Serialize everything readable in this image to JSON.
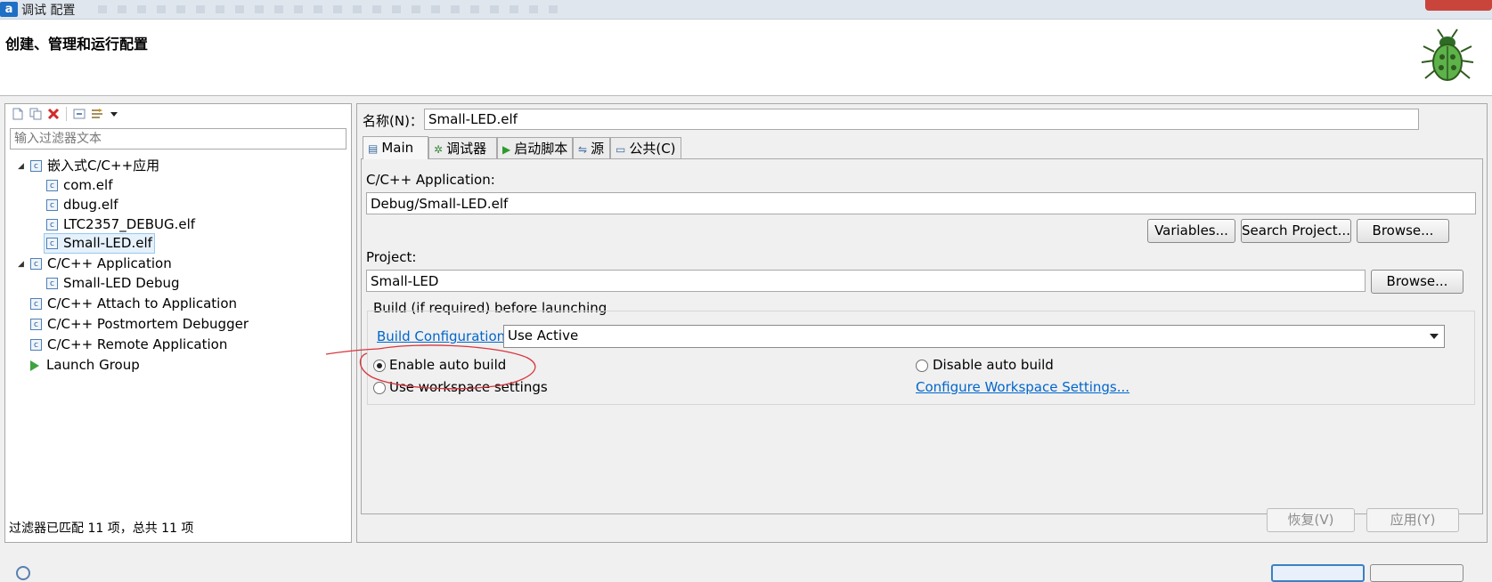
{
  "window": {
    "title": "调试 配置",
    "app_icon_glyph": "a"
  },
  "header": {
    "title": "创建、管理和运行配置",
    "icon": "bug-icon"
  },
  "left_panel": {
    "toolbar_icons": [
      "new-config-icon",
      "duplicate-icon",
      "delete-icon",
      "collapse-all-icon",
      "filter-icon",
      "dropdown-arrow-icon"
    ],
    "filter_placeholder": "输入过滤器文本",
    "tree": [
      {
        "label": "嵌入式C/C++应用",
        "level": 0,
        "expanded": true,
        "icon": "c-config-icon"
      },
      {
        "label": "com.elf",
        "level": 1,
        "icon": "c-config-icon"
      },
      {
        "label": "dbug.elf",
        "level": 1,
        "icon": "c-config-icon"
      },
      {
        "label": "LTC2357_DEBUG.elf",
        "level": 1,
        "icon": "c-config-icon"
      },
      {
        "label": "Small-LED.elf",
        "level": 1,
        "icon": "c-config-icon",
        "selected": true
      },
      {
        "label": "C/C++ Application",
        "level": 0,
        "expanded": true,
        "icon": "c-config-icon"
      },
      {
        "label": "Small-LED Debug",
        "level": 1,
        "icon": "c-config-icon"
      },
      {
        "label": "C/C++ Attach to Application",
        "level": 0,
        "icon": "c-config-icon"
      },
      {
        "label": "C/C++ Postmortem Debugger",
        "level": 0,
        "icon": "c-config-icon"
      },
      {
        "label": "C/C++ Remote Application",
        "level": 0,
        "icon": "c-config-icon"
      },
      {
        "label": "Launch Group",
        "level": 0,
        "icon": "launch-group-icon"
      }
    ],
    "status": "过滤器已匹配 11 项，总共 11 项"
  },
  "config": {
    "name_label": "名称(N)：",
    "name_value": "Small-LED.elf",
    "tabs": [
      {
        "label": "Main",
        "icon": "main-tab-icon",
        "active": true
      },
      {
        "label": "调试器",
        "icon": "debugger-icon"
      },
      {
        "label": "启动脚本",
        "icon": "startup-icon"
      },
      {
        "label": "源",
        "icon": "source-icon"
      },
      {
        "label": "公共(C)",
        "icon": "common-icon"
      }
    ],
    "main": {
      "application_label": "C/C++ Application:",
      "application_value": "Debug/Small-LED.elf",
      "variables_button": "Variables...",
      "search_project_button": "Search Project...",
      "browse_button": "Browse...",
      "project_label": "Project:",
      "project_value": "Small-LED",
      "project_browse_button": "Browse...",
      "build_group_title": "Build (if required) before launching",
      "build_config_link": "Build Configuration:",
      "build_config_value": "Use Active",
      "enable_auto_build": "Enable auto build",
      "disable_auto_build": "Disable auto build",
      "use_workspace_settings": "Use workspace settings",
      "configure_workspace_link": "Configure Workspace Settings...",
      "selected_build_option": "enable"
    },
    "revert_button": "恢复(V)",
    "apply_button": "应用(Y)"
  },
  "colors": {
    "link": "#0066cc",
    "annotation": "#d9363e",
    "selection_bg": "#e5f1fb"
  }
}
